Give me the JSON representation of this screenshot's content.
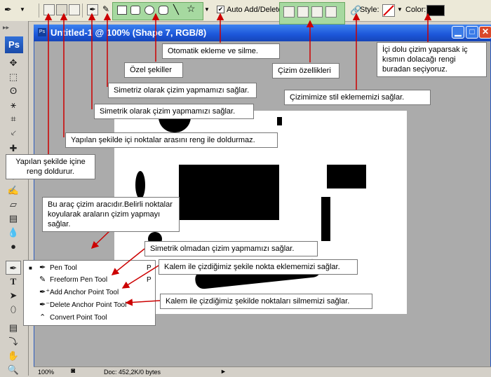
{
  "options_bar": {
    "auto_add_delete_label": "Auto Add/Delete",
    "auto_add_delete_checked": true,
    "style_label": "Style:",
    "color_label": "Color:",
    "color_value": "#000000"
  },
  "document": {
    "title": "Untitled-1 @ 100% (Shape 7, RGB/8)",
    "zoom": "100%",
    "doc_info": "Doc: 452,2K/0 bytes"
  },
  "toolbox": {
    "logo": "Ps"
  },
  "flyout": {
    "items": [
      {
        "label": "Pen Tool",
        "key": "P",
        "selected": true
      },
      {
        "label": "Freeform Pen Tool",
        "key": "P",
        "selected": false
      },
      {
        "label": "Add Anchor Point Tool",
        "key": "",
        "selected": false
      },
      {
        "label": "Delete Anchor Point Tool",
        "key": "",
        "selected": false
      },
      {
        "label": "Convert Point Tool",
        "key": "",
        "selected": false
      }
    ]
  },
  "callouts": {
    "otomatik": "Otomatik ekleme ve silme.",
    "ozel_sekiller": "Özel şekiller",
    "cizim_ozellikleri": "Çizim özellikleri",
    "simetriz": "Simetriz olarak çizim yapmamızı sağlar.",
    "simetrik": "Simetrik olarak çizim yapmamızı sağlar.",
    "stil": "Çizimimize stil eklememizi sağlar.",
    "ici_dolu": "İçi dolu çizim yaparsak iç kısmın dolacağı rengi buradan seçiyoruz.",
    "yapilan_noktalar": "Yapılan şekilde içi noktalar arasını reng ile doldurmaz.",
    "yapilan_doldurur": "Yapılan şekilde içine reng doldurur.",
    "bu_arac": "Bu araç çizim aracıdır.Belirli noktalar koyularak araların çizim yapmayı sağlar.",
    "simetrik_olmadan": "Simetrik olmadan çizim yapmamızı sağlar.",
    "nokta_ekleme": "Kalem ile çizdiğimiz şekile nokta eklememizi sağlar.",
    "nokta_silme": "Kalem ile çizdiğimiz şekilde noktaları silmemizi sağlar."
  }
}
